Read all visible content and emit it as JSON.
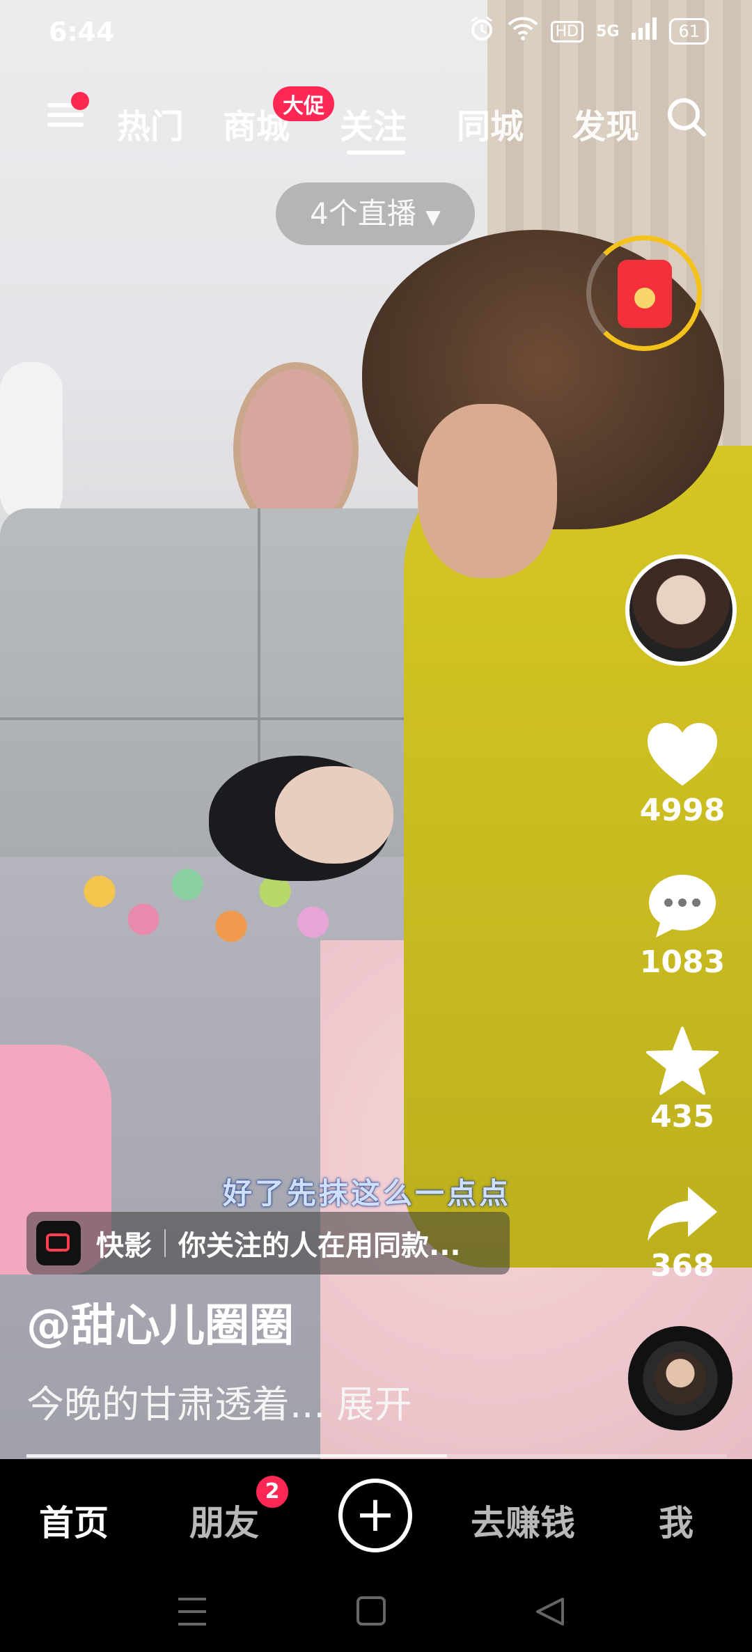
{
  "status_bar": {
    "time": "6:44",
    "network": "5G",
    "hd_label": "HD",
    "battery": "61",
    "icons": [
      "alarm-icon",
      "wifi-icon",
      "hd-icon",
      "signal-icon",
      "battery-icon"
    ]
  },
  "top_nav": {
    "tabs": [
      {
        "label": "热门"
      },
      {
        "label": "商城",
        "badge": "大促"
      },
      {
        "label": "关注",
        "active": true
      },
      {
        "label": "同城"
      },
      {
        "label": "发现"
      }
    ],
    "menu_has_dot": true
  },
  "live_selector": {
    "label": "4个直播"
  },
  "video": {
    "subtitle": "好了先抹这么一点点",
    "app_chip": {
      "app_name": "快影",
      "text": "你关注的人在用同款..."
    },
    "author": "@甜心儿圈圈",
    "description": "今晚的甘肃透着...",
    "expand_label": "展开",
    "progress": 0.6
  },
  "right_rail": {
    "likes": "4998",
    "comments": "1083",
    "favorites": "435",
    "shares": "368"
  },
  "bottom_tabs": {
    "home": "首页",
    "friends": "朋友",
    "friends_badge": "2",
    "add": "+",
    "earn": "去赚钱",
    "me": "我"
  },
  "colors": {
    "accent_red": "#ff2855",
    "redpacket_ring": "#f5c21b",
    "tabbar_bg": "#000000"
  }
}
